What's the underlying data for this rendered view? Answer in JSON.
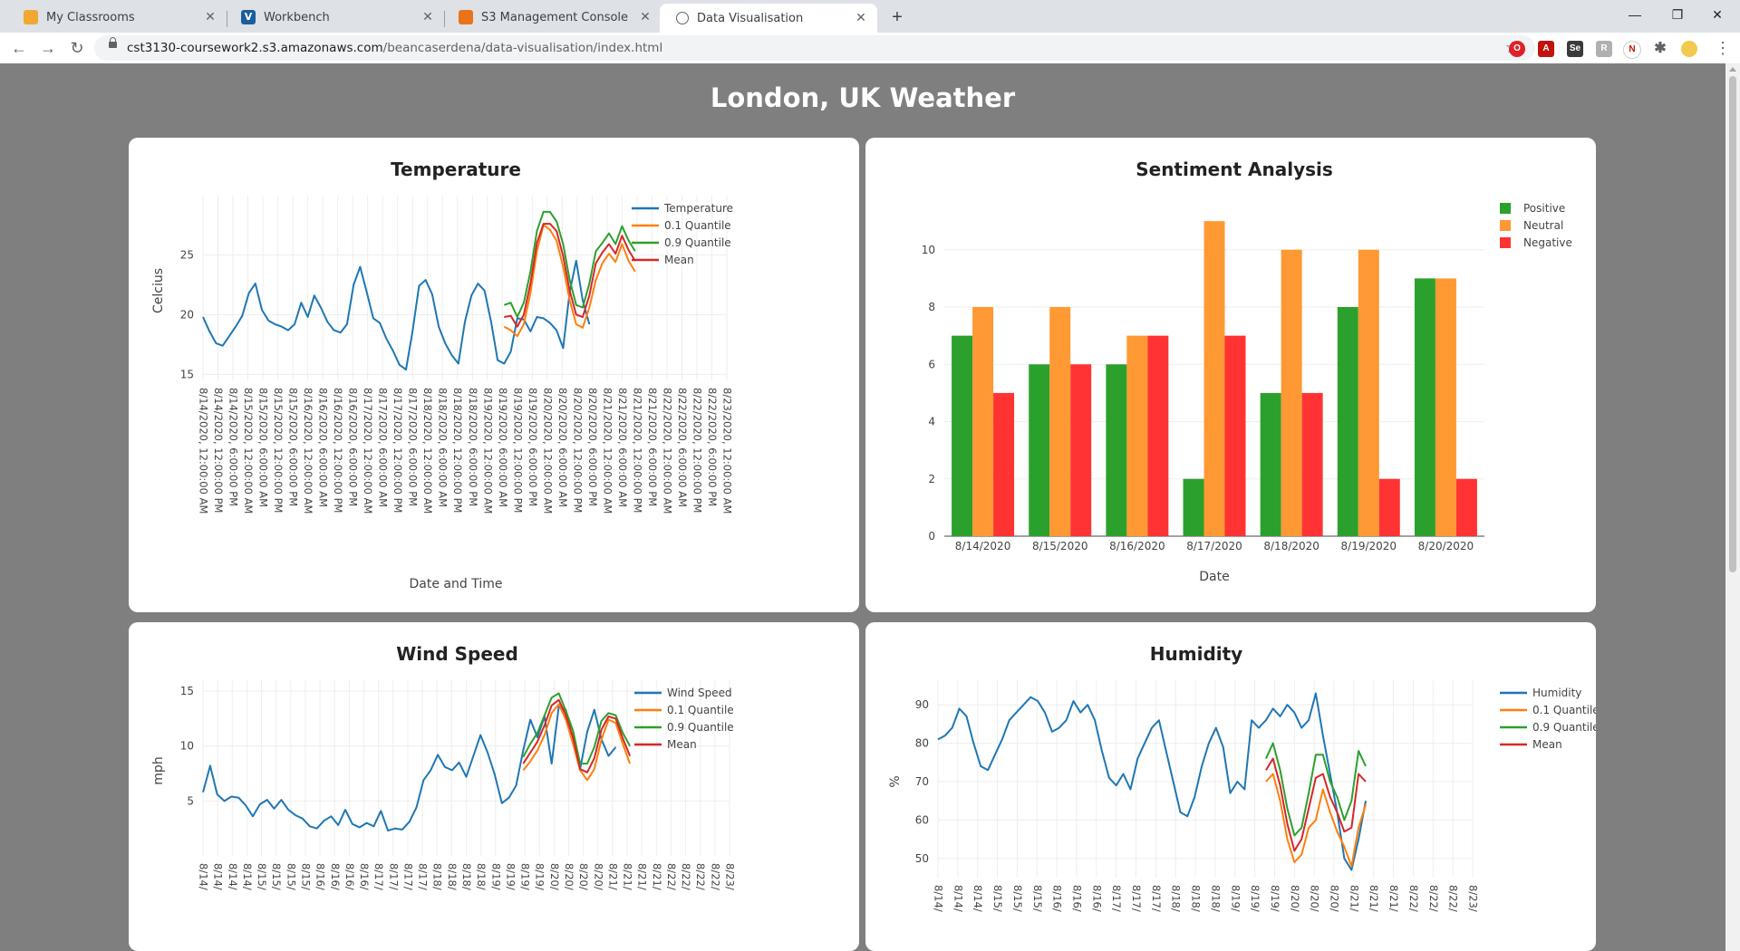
{
  "browser": {
    "tabs": [
      {
        "label": "My Classrooms",
        "icon": "classroom-icon",
        "active": false
      },
      {
        "label": "Workbench",
        "icon": "vocareum-icon",
        "active": false
      },
      {
        "label": "S3 Management Console",
        "icon": "aws-icon",
        "active": false
      },
      {
        "label": "Data Visualisation",
        "icon": "globe-icon",
        "active": true
      }
    ],
    "url_host": "cst3130-coursework2.s3.amazonaws.com",
    "url_path": "/beancaserdena/data-visualisation/index.html"
  },
  "page": {
    "heading": "London, UK Weather"
  },
  "colors": {
    "blue": "#1f77b4",
    "orange": "#ff7f0e",
    "green": "#2ca02c",
    "red": "#d62728",
    "bar_green": "#2ca02c",
    "bar_orange": "#ff9933",
    "bar_red": "#ff3333",
    "page_bg": "#7f7f7f"
  },
  "chart_data": [
    {
      "type": "line",
      "title": "Temperature",
      "xlabel": "Date and Time",
      "ylabel": "Celcius",
      "yticks": [
        15,
        20,
        25
      ],
      "ylim": [
        14.5,
        29.5
      ],
      "xticks": [
        "8/14/2020, 12:00:00 AM",
        "8/14/2020, 12:00:00 PM",
        "8/14/2020, 6:00:00 PM",
        "8/15/2020, 12:00:00 AM",
        "8/15/2020, 6:00:00 AM",
        "8/15/2020, 12:00:00 PM",
        "8/15/2020, 6:00:00 PM",
        "8/16/2020, 12:00:00 AM",
        "8/16/2020, 6:00:00 AM",
        "8/16/2020, 12:00:00 PM",
        "8/16/2020, 6:00:00 PM",
        "8/17/2020, 12:00:00 AM",
        "8/17/2020, 6:00:00 AM",
        "8/17/2020, 12:00:00 PM",
        "8/17/2020, 6:00:00 PM",
        "8/18/2020, 12:00:00 AM",
        "8/18/2020, 6:00:00 AM",
        "8/18/2020, 12:00:00 PM",
        "8/18/2020, 6:00:00 PM",
        "8/19/2020, 12:00:00 AM",
        "8/19/2020, 6:00:00 AM",
        "8/19/2020, 12:00:00 PM",
        "8/19/2020, 6:00:00 PM",
        "8/20/2020, 12:00:00 AM",
        "8/20/2020, 6:00:00 AM",
        "8/20/2020, 12:00:00 PM",
        "8/20/2020, 6:00:00 PM",
        "8/21/2020, 12:00:00 AM",
        "8/21/2020, 6:00:00 AM",
        "8/21/2020, 12:00:00 PM",
        "8/21/2020, 6:00:00 PM",
        "8/22/2020, 12:00:00 AM",
        "8/22/2020, 6:00:00 AM",
        "8/22/2020, 12:00:00 PM",
        "8/22/2020, 6:00:00 PM",
        "8/23/2020, 12:00:00 AM"
      ],
      "legend": [
        "Temperature",
        "0.1 Quantile",
        "0.9 Quantile",
        "Mean"
      ],
      "series": [
        {
          "name": "Temperature",
          "values": [
            19.8,
            18.6,
            17.6,
            17.4,
            18.2,
            19.0,
            19.9,
            21.8,
            22.6,
            20.4,
            19.5,
            19.2,
            19.0,
            18.7,
            19.2,
            21.0,
            19.8,
            21.6,
            20.6,
            19.4,
            18.7,
            18.5,
            19.2,
            22.5,
            24.0,
            21.9,
            19.7,
            19.3,
            18.0,
            17.0,
            15.8,
            15.4,
            18.6,
            22.4,
            22.9,
            21.7,
            19.0,
            17.6,
            16.6,
            15.9,
            19.4,
            21.6,
            22.6,
            22.0,
            19.4,
            16.2,
            15.9,
            16.9,
            19.7,
            19.6,
            18.6,
            19.8,
            19.7,
            19.3,
            18.7,
            17.2,
            21.9,
            24.5,
            21.2,
            19.2
          ]
        },
        {
          "name": "0.1 Quantile",
          "values": [
            19.0,
            18.7,
            18.2,
            19.2,
            21.8,
            25.3,
            27.5,
            27.1,
            26.2,
            24.0,
            21.2,
            19.2,
            18.9,
            20.6,
            22.9,
            24.3,
            25.1,
            24.4,
            25.9,
            24.5,
            23.6
          ]
        },
        {
          "name": "0.9 Quantile",
          "values": [
            20.8,
            21.0,
            19.8,
            21.0,
            23.6,
            27.0,
            28.6,
            28.6,
            27.8,
            25.9,
            22.9,
            20.8,
            20.6,
            22.6,
            25.3,
            26.0,
            26.8,
            25.9,
            27.4,
            26.2,
            25.3
          ]
        },
        {
          "name": "Mean",
          "values": [
            19.8,
            19.9,
            19.0,
            20.0,
            22.6,
            26.0,
            27.6,
            27.6,
            27.0,
            24.9,
            22.0,
            20.0,
            19.8,
            21.6,
            24.3,
            25.2,
            25.9,
            25.1,
            26.6,
            25.4,
            24.5
          ]
        }
      ]
    },
    {
      "type": "bar",
      "title": "Sentiment Analysis",
      "xlabel": "Date",
      "ylabel": "",
      "yticks": [
        0,
        2,
        4,
        6,
        8,
        10
      ],
      "ylim": [
        0,
        11.7
      ],
      "categories": [
        "8/14/2020",
        "8/15/2020",
        "8/16/2020",
        "8/17/2020",
        "8/18/2020",
        "8/19/2020",
        "8/20/2020"
      ],
      "series": [
        {
          "name": "Positive",
          "values": [
            7,
            6,
            6,
            2,
            5,
            8,
            9
          ]
        },
        {
          "name": "Neutral",
          "values": [
            8,
            8,
            7,
            11,
            10,
            10,
            9
          ]
        },
        {
          "name": "Negative",
          "values": [
            5,
            6,
            7,
            7,
            5,
            2,
            2
          ]
        }
      ]
    },
    {
      "type": "line",
      "title": "Wind Speed",
      "xlabel": "",
      "ylabel": "mph",
      "yticks": [
        5,
        10,
        15
      ],
      "ylim": [
        0,
        15.5
      ],
      "xticks": [
        "8/14/",
        "8/14/",
        "8/14/",
        "8/14/",
        "8/15/",
        "8/15/",
        "8/15/",
        "8/15/",
        "8/16/",
        "8/16/",
        "8/16/",
        "8/16/",
        "8/17/",
        "8/17/",
        "8/17/",
        "8/17/",
        "8/18/",
        "8/18/",
        "8/18/",
        "8/18/",
        "8/19/",
        "8/19/",
        "8/19/",
        "8/19/",
        "8/20/",
        "8/20/",
        "8/20/",
        "8/20/",
        "8/21/",
        "8/21/",
        "8/21/",
        "8/21/",
        "8/22/",
        "8/22/",
        "8/22/",
        "8/22/",
        "8/23/"
      ],
      "legend": [
        "Wind Speed",
        "0.1 Quantile",
        "0.9 Quantile",
        "Mean"
      ],
      "series": [
        {
          "name": "Wind Speed",
          "values": [
            5.8,
            8.2,
            5.6,
            5.0,
            5.4,
            5.3,
            4.6,
            3.6,
            4.7,
            5.1,
            4.3,
            5.1,
            4.2,
            3.7,
            3.4,
            2.7,
            2.5,
            3.2,
            3.6,
            2.8,
            4.2,
            2.9,
            2.6,
            3.0,
            2.7,
            4.1,
            2.3,
            2.5,
            2.4,
            3.1,
            4.4,
            6.9,
            7.8,
            9.2,
            8.1,
            7.8,
            8.5,
            7.2,
            9.1,
            11.0,
            9.4,
            7.4,
            4.8,
            5.3,
            6.4,
            9.6,
            12.4,
            10.8,
            12.7,
            8.4,
            13.6,
            13.3,
            10.5,
            7.9,
            11.3,
            13.3,
            10.6,
            9.1,
            9.9
          ]
        },
        {
          "name": "0.1 Quantile",
          "values": [
            7.8,
            8.6,
            9.6,
            11.0,
            13.0,
            13.8,
            12.4,
            10.2,
            7.8,
            6.9,
            7.9,
            10.6,
            12.4,
            12.1,
            10.2,
            8.4
          ]
        },
        {
          "name": "0.9 Quantile",
          "values": [
            9.0,
            10.2,
            11.2,
            12.8,
            14.4,
            14.8,
            13.2,
            11.4,
            8.4,
            8.4,
            9.9,
            12.3,
            13.0,
            12.8,
            11.2,
            10.0
          ]
        },
        {
          "name": "Mean",
          "values": [
            8.4,
            9.4,
            10.4,
            11.9,
            13.7,
            14.2,
            12.8,
            10.8,
            7.9,
            7.6,
            8.9,
            11.5,
            12.7,
            12.5,
            10.7,
            9.1
          ]
        }
      ]
    },
    {
      "type": "line",
      "title": "Humidity",
      "xlabel": "",
      "ylabel": "%",
      "yticks": [
        50,
        60,
        70,
        80,
        90
      ],
      "ylim": [
        45,
        95
      ],
      "xticks": [
        "8/14/",
        "8/14/",
        "8/14/",
        "8/15/",
        "8/15/",
        "8/15/",
        "8/16/",
        "8/16/",
        "8/16/",
        "8/17/",
        "8/17/",
        "8/17/",
        "8/18/",
        "8/18/",
        "8/18/",
        "8/19/",
        "8/19/",
        "8/19/",
        "8/20/",
        "8/20/",
        "8/20/",
        "8/21/",
        "8/21/",
        "8/21/",
        "8/22/",
        "8/22/",
        "8/22/",
        "8/23/"
      ],
      "legend": [
        "Humidity",
        "0.1 Quantile",
        "0.9 Quantile",
        "Mean"
      ],
      "series": [
        {
          "name": "Humidity",
          "values": [
            81,
            82,
            84,
            89,
            87,
            80,
            74,
            73,
            77,
            81,
            86,
            88,
            90,
            92,
            91,
            88,
            83,
            84,
            86,
            91,
            88,
            90,
            86,
            78,
            71,
            69,
            72,
            68,
            76,
            80,
            84,
            86,
            78,
            70,
            62,
            61,
            66,
            74,
            80,
            84,
            79,
            67,
            70,
            68,
            86,
            84,
            86,
            89,
            87,
            90,
            88,
            84,
            86,
            93,
            82,
            72,
            62,
            50,
            47,
            55,
            65
          ]
        },
        {
          "name": "0.1 Quantile",
          "values": [
            70,
            72,
            65,
            55,
            49,
            51,
            58,
            60,
            68,
            62,
            57,
            53,
            48,
            58,
            64
          ]
        },
        {
          "name": "0.9 Quantile",
          "values": [
            76,
            80,
            73,
            63,
            56,
            58,
            67,
            77,
            77,
            70,
            66,
            60,
            65,
            78,
            74
          ]
        },
        {
          "name": "Mean",
          "values": [
            73,
            76,
            69,
            59,
            52,
            55,
            63,
            71,
            72,
            66,
            62,
            57,
            58,
            72,
            70
          ]
        }
      ]
    }
  ]
}
